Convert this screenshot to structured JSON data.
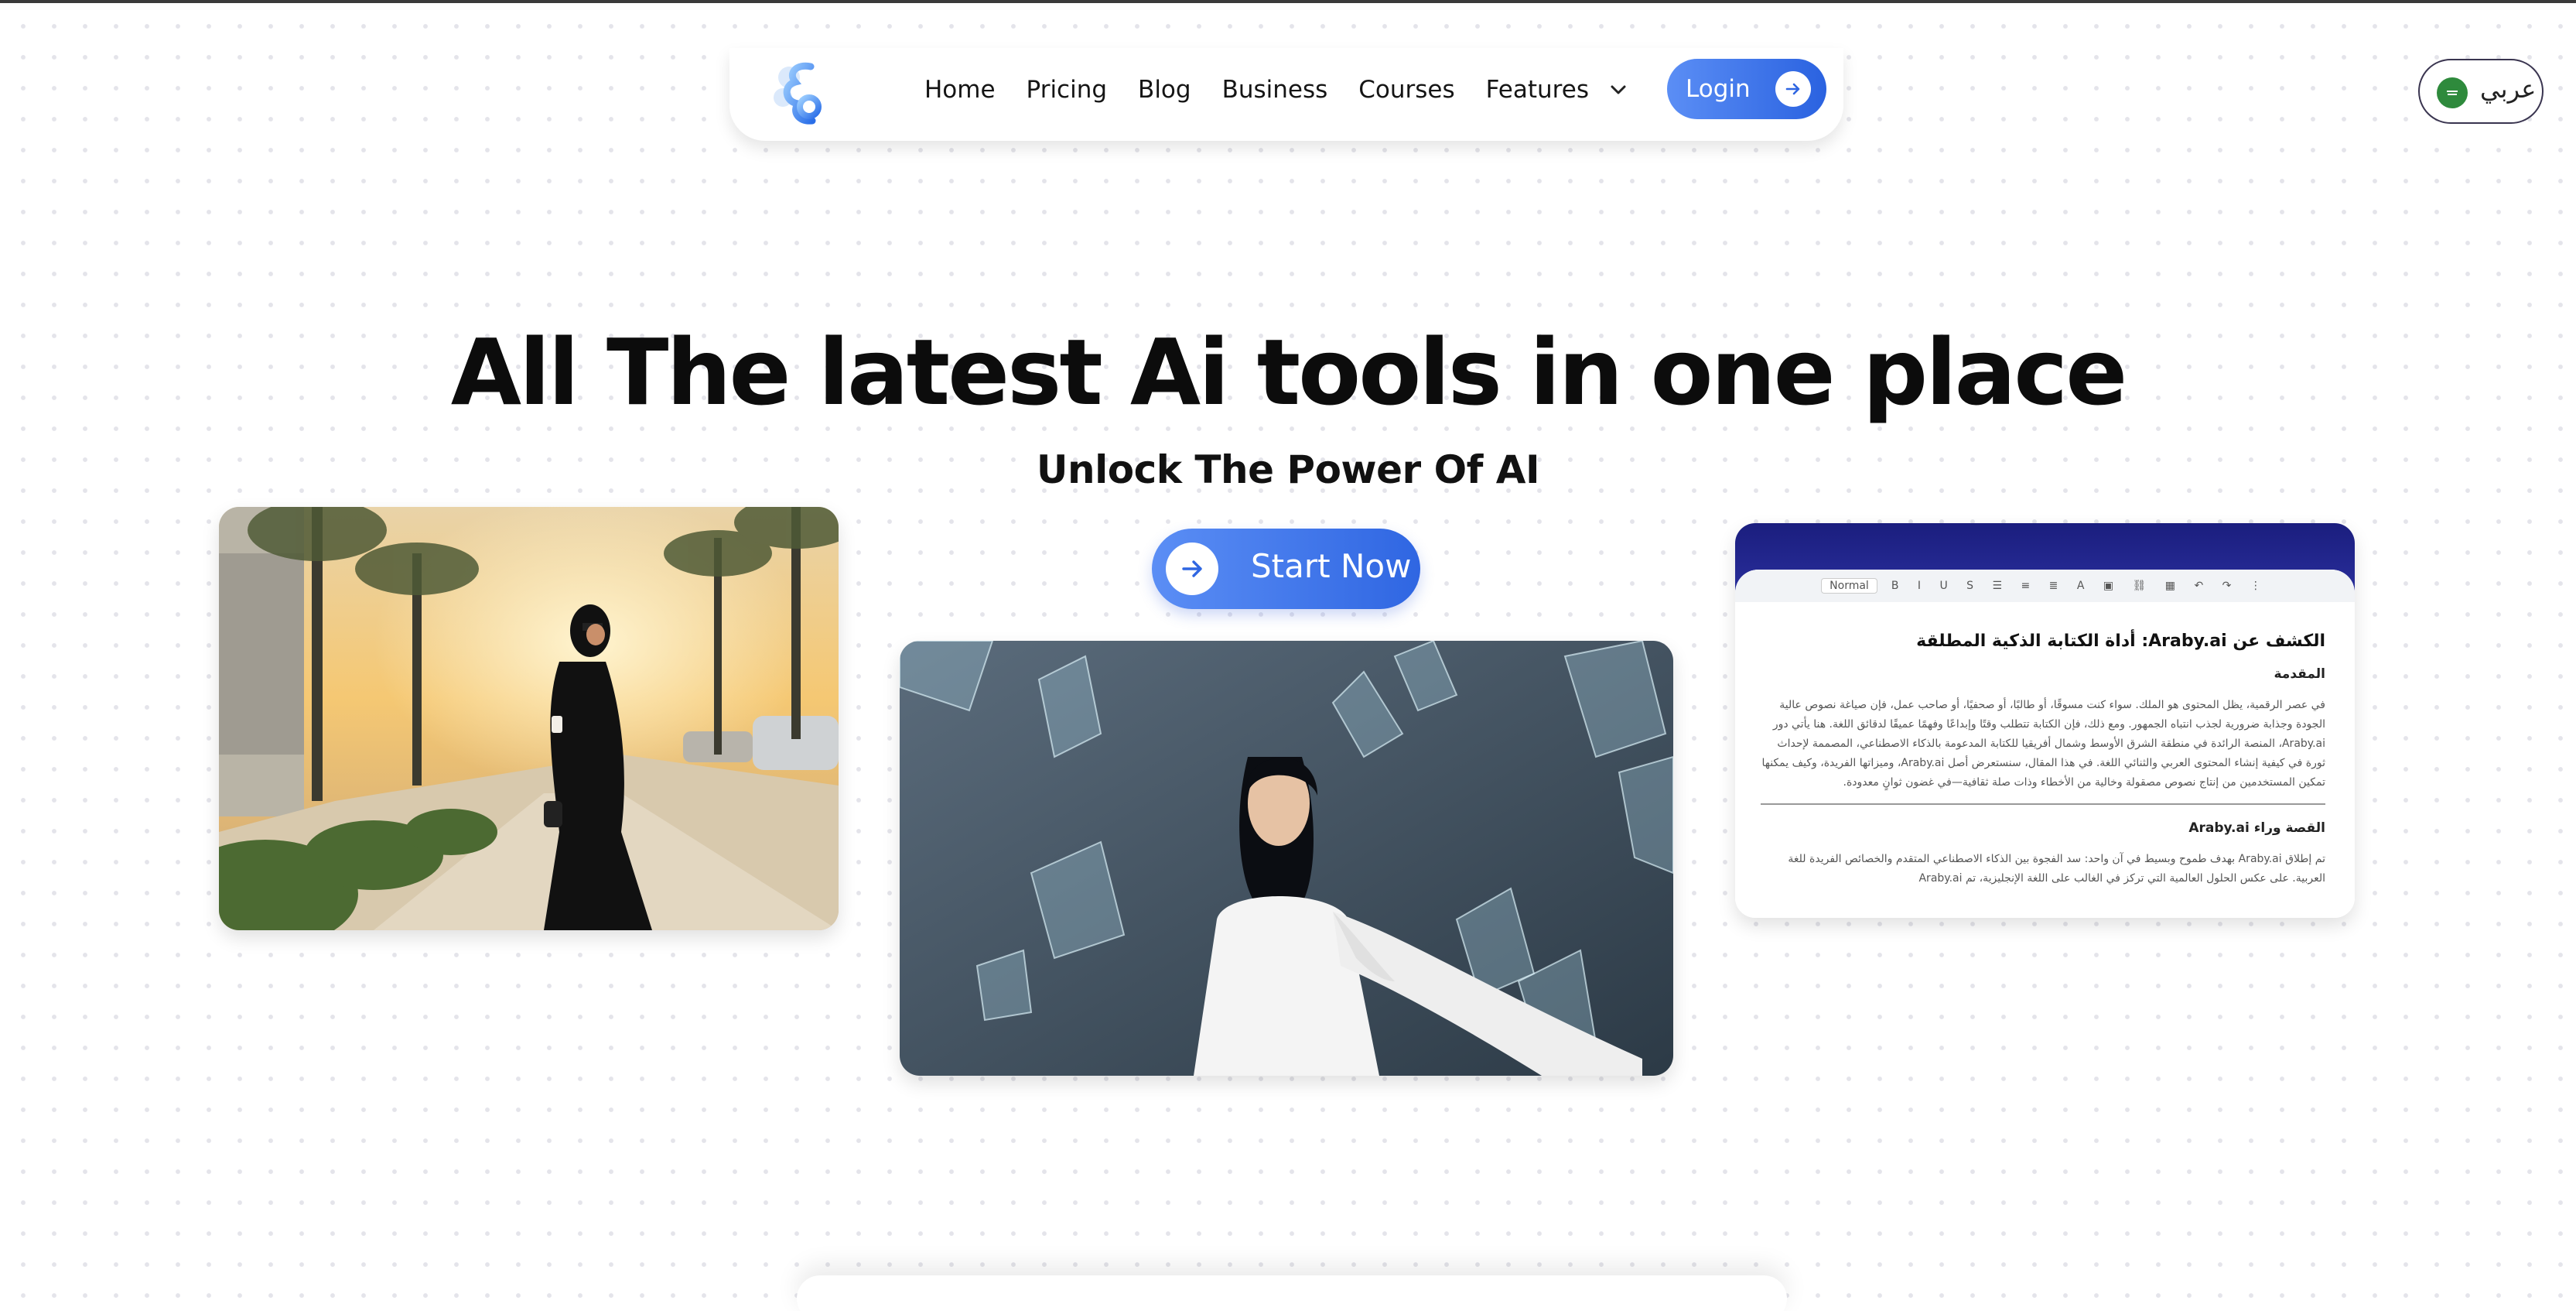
{
  "nav": {
    "logo_alt": "Araby.ai logo",
    "links": [
      "Home",
      "Pricing",
      "Blog",
      "Business",
      "Courses"
    ],
    "features_label": "Features",
    "login_label": "Login"
  },
  "language": {
    "label": "عربي"
  },
  "hero": {
    "title": "All The latest Ai tools in one place",
    "subtitle": "Unlock The Power Of AI",
    "cta_label": "Start Now"
  },
  "doc_card": {
    "toolbar_style": "Normal",
    "heading": "الكشف عن Araby.ai: أداة الكتابة الذكية المطلقة",
    "intro_heading": "المقدمة",
    "intro_paragraph": "في عصر الرقمية، يظل المحتوى هو الملك. سواء كنت مسوقًا، أو طالبًا، أو صحفيًا، أو صاحب عمل، فإن صياغة نصوص عالية الجودة وجذابة ضرورية لجذب انتباه الجمهور. ومع ذلك، فإن الكتابة تتطلب وقتًا وإبداعًا وفهمًا عميقًا لدقائق اللغة. هنا يأتي دور Araby.ai، المنصة الرائدة في منطقة الشرق الأوسط وشمال أفريقيا للكتابة المدعومة بالذكاء الاصطناعي، المصممة لإحداث ثورة في كيفية إنشاء المحتوى العربي والثنائي اللغة. في هذا المقال، سنستعرض أصل Araby.ai، وميزاتها الفريدة، وكيف يمكنها تمكين المستخدمين من إنتاج نصوص مصقولة وخالية من الأخطاء وذات صلة ثقافية—في غضون ثوانٍ معدودة.",
    "story_heading": "القصة وراء Araby.ai",
    "story_paragraph": "تم إطلاق Araby.ai بهدف طموح وبسيط في آن واحد: سد الفجوة بين الذكاء الاصطناعي المتقدم والخصائص الفريدة للغة العربية. على عكس الحلول العالمية التي تركز في الغالب على اللغة الإنجليزية، تم Araby.ai"
  },
  "colors": {
    "brand_blue": "#3b74ea",
    "doc_header": "#1b1e7e",
    "flag_green": "#2e8a3c"
  },
  "icons": [
    "logo-icon",
    "chevron-down-icon",
    "arrow-right-icon",
    "saudi-flag-icon"
  ]
}
